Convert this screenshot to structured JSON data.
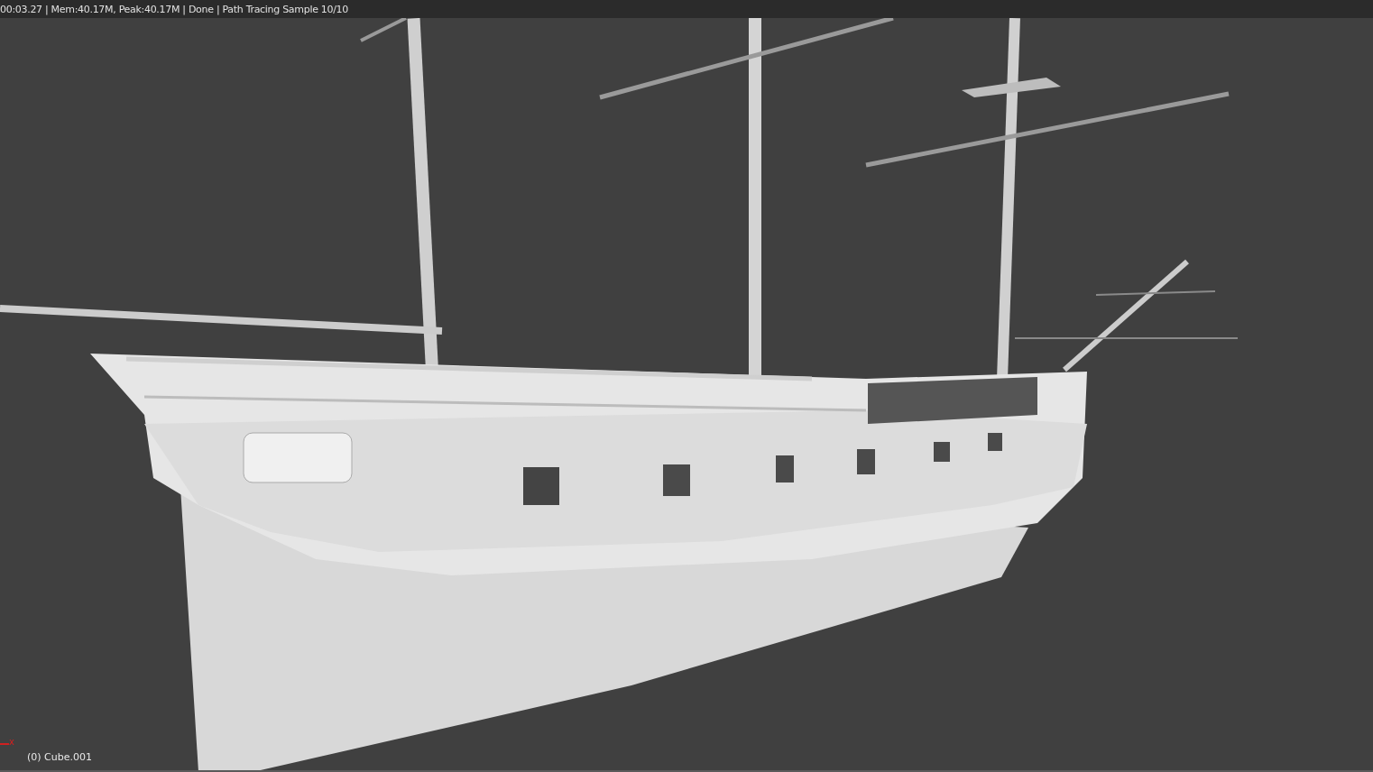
{
  "render_header": {
    "status": "00:03.27 | Mem:40.17M, Peak:40.17M | Done | Path Tracing Sample 10/10"
  },
  "viewport": {
    "axis_label": "x",
    "object_name": "(0) Cube.001"
  }
}
